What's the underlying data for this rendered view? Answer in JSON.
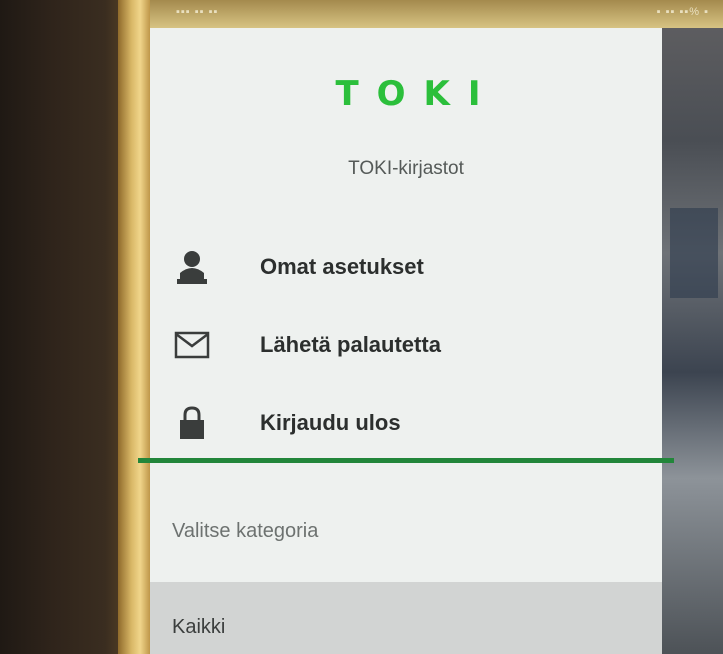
{
  "status_bar": {
    "left": "▪▪▪ ▪▪ ▪▪",
    "right": "▪ ▪▪ ▪▪% ▪"
  },
  "logo": {
    "letters": [
      "T",
      "O",
      "K",
      "I"
    ],
    "subtitle": "",
    "color": "#2bbf3b"
  },
  "header": {
    "library_name": "TOKI-kirjastot"
  },
  "menu": {
    "items": [
      {
        "label": "Omat asetukset",
        "icon": "person-icon"
      },
      {
        "label": "Lähetä palautetta",
        "icon": "envelope-icon"
      },
      {
        "label": "Kirjaudu ulos",
        "icon": "lock-icon"
      }
    ]
  },
  "categories": {
    "title": "Valitse kategoria",
    "selected": "Kaikki"
  },
  "colors": {
    "accent_divider": "#22863a",
    "drawer_bg": "#eef1ef",
    "selected_bg": "#d2d4d3"
  }
}
